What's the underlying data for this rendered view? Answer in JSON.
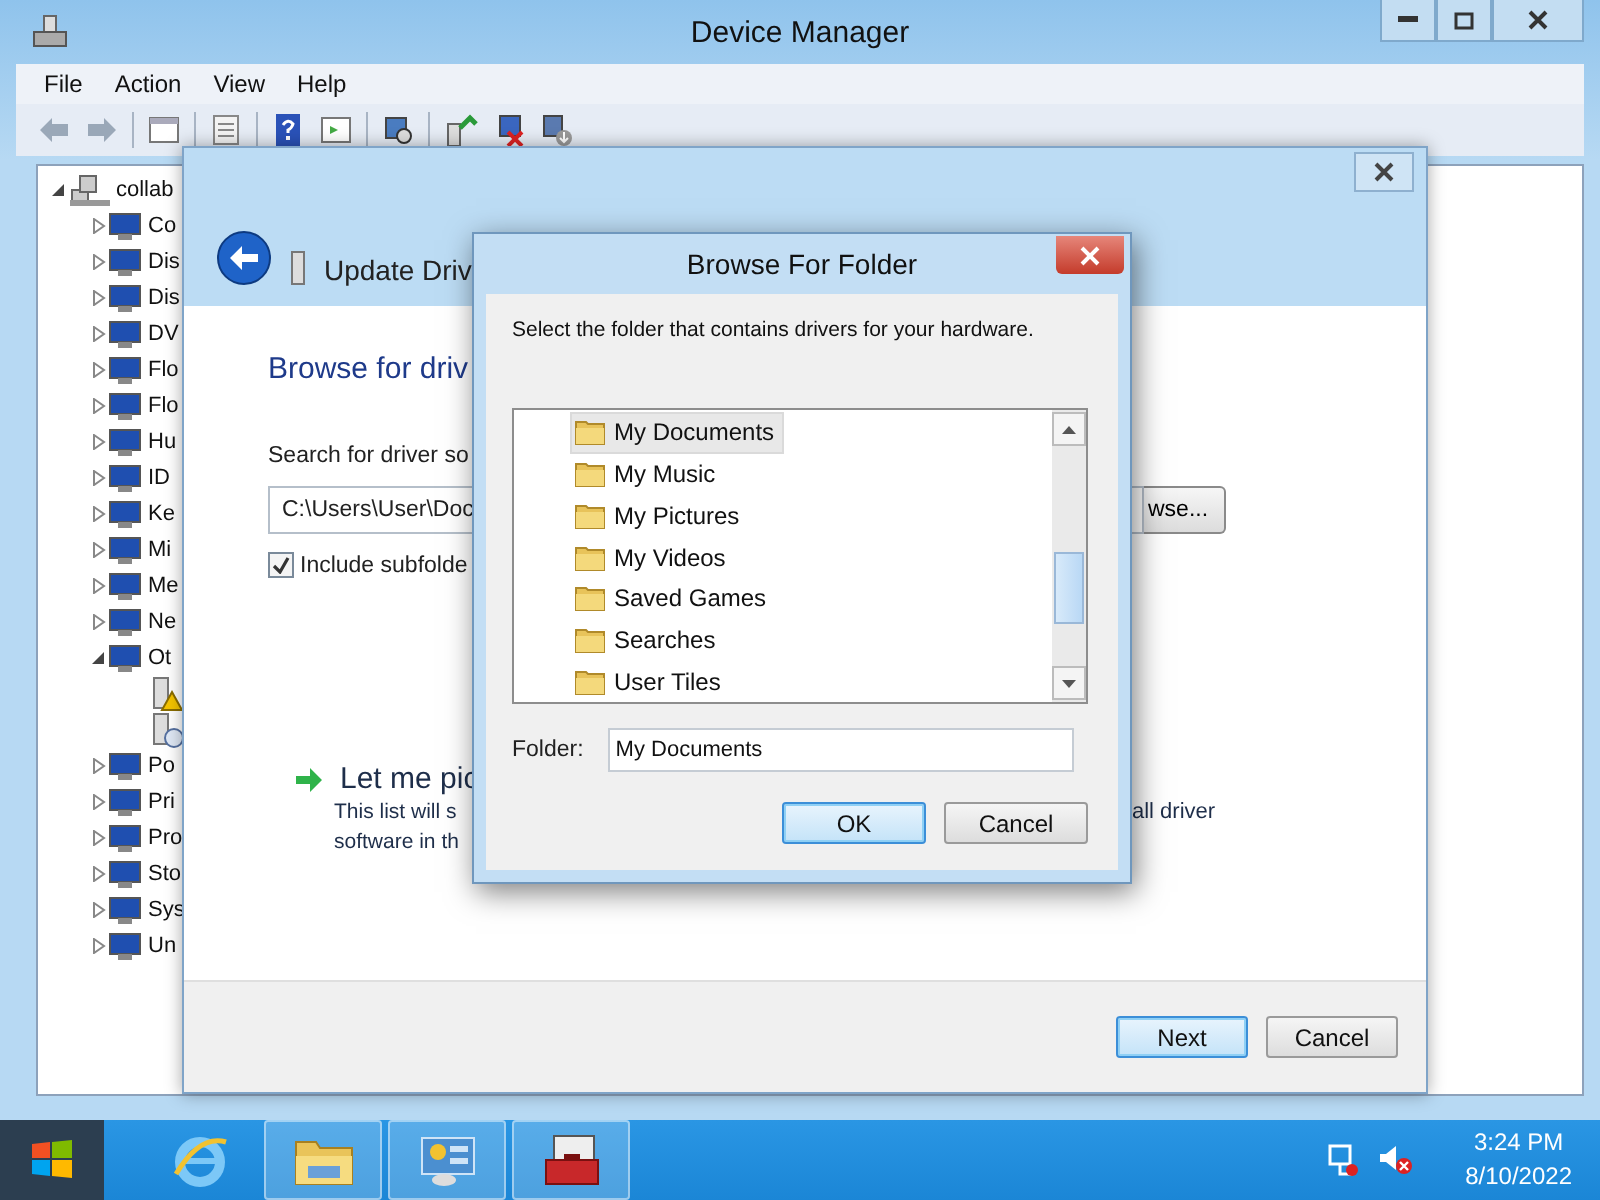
{
  "device_manager": {
    "title": "Device Manager",
    "menu": [
      "File",
      "Action",
      "View",
      "Help"
    ],
    "tree": {
      "label": "collab",
      "expanded": true,
      "children": [
        {
          "label": "Co",
          "expanded": false
        },
        {
          "label": "Dis",
          "expanded": false
        },
        {
          "label": "Dis",
          "expanded": false
        },
        {
          "label": "DV",
          "expanded": false
        },
        {
          "label": "Flo",
          "expanded": false
        },
        {
          "label": "Flo",
          "expanded": false
        },
        {
          "label": "Hu",
          "expanded": false
        },
        {
          "label": "ID",
          "expanded": false
        },
        {
          "label": "Ke",
          "expanded": false
        },
        {
          "label": "Mi",
          "expanded": false
        },
        {
          "label": "Me",
          "expanded": false
        },
        {
          "label": "Ne",
          "expanded": false
        },
        {
          "label": "Ot",
          "expanded": true,
          "children": [
            {
              "kind": "warning"
            },
            {
              "kind": "unknown"
            }
          ]
        },
        {
          "label": "Po",
          "expanded": false
        },
        {
          "label": "Pri",
          "expanded": false
        },
        {
          "label": "Pro",
          "expanded": false
        },
        {
          "label": "Sto",
          "expanded": false
        },
        {
          "label": "Sys",
          "expanded": false
        },
        {
          "label": "Un",
          "expanded": false
        }
      ]
    }
  },
  "update_driver": {
    "title": "Update Driv",
    "heading": "Browse for driv",
    "search_label": "Search for driver so",
    "path": "C:\\Users\\User\\Doc",
    "browse_button": "wse...",
    "include_subfolders": {
      "label": "Include subfolde",
      "checked": true
    },
    "pick_title": "Let me pic",
    "pick_lines": [
      "This list will s",
      "software in th"
    ],
    "pick_tail": "all driver",
    "buttons": [
      {
        "label": "Next",
        "default": true
      },
      {
        "label": "Cancel",
        "default": false
      }
    ]
  },
  "browse_dialog": {
    "title": "Browse For Folder",
    "instruction": "Select the folder that contains drivers for your hardware.",
    "folders": [
      {
        "name": "My Documents",
        "selected": true
      },
      {
        "name": "My Music",
        "selected": false
      },
      {
        "name": "My Pictures",
        "selected": false
      },
      {
        "name": "My Videos",
        "selected": false
      },
      {
        "name": "Saved Games",
        "selected": false
      },
      {
        "name": "Searches",
        "selected": false
      },
      {
        "name": "User Tiles",
        "selected": false
      }
    ],
    "folder_label": "Folder:",
    "folder_value": "My Documents",
    "buttons": [
      {
        "label": "OK",
        "default": true
      },
      {
        "label": "Cancel",
        "default": false
      }
    ]
  },
  "taskbar": {
    "apps": [
      {
        "kind": "browser",
        "running": false
      },
      {
        "kind": "explorer",
        "running": true
      },
      {
        "kind": "control-panel",
        "running": true
      },
      {
        "kind": "device-manager",
        "running": true
      }
    ],
    "time": "3:24 PM",
    "date": "8/10/2022"
  }
}
